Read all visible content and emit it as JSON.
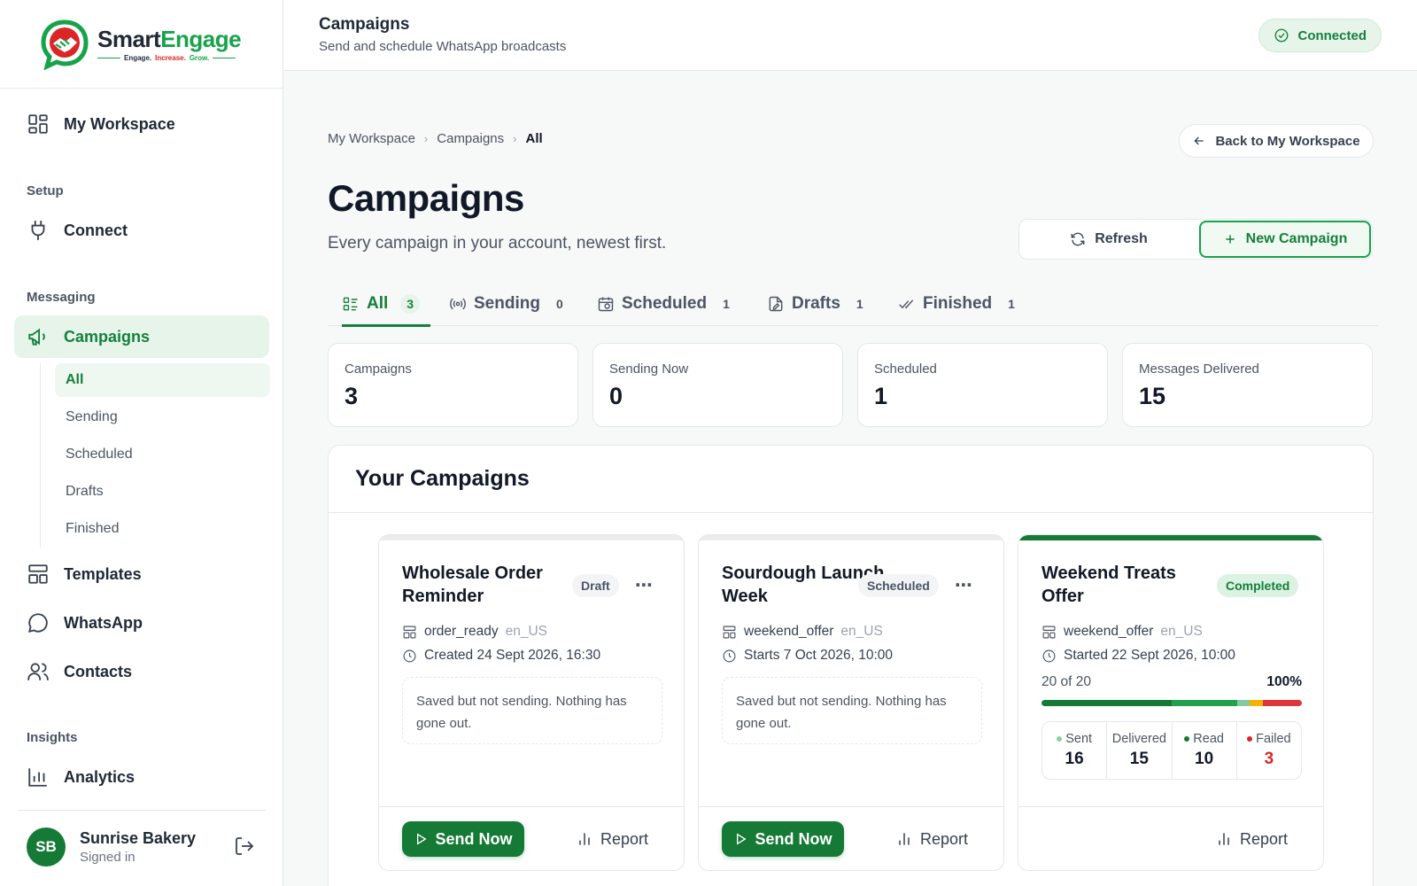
{
  "brand": {
    "name_part1": "Smart",
    "name_part2": "Engage",
    "tag1": "Engage.",
    "tag2": "Increase.",
    "tag3": "Grow."
  },
  "sidebar": {
    "workspace": "My Workspace",
    "setup_label": "Setup",
    "connect": "Connect",
    "messaging_label": "Messaging",
    "campaigns": "Campaigns",
    "sub": [
      "All",
      "Sending",
      "Scheduled",
      "Drafts",
      "Finished"
    ],
    "templates": "Templates",
    "whatsapp": "WhatsApp",
    "contacts": "Contacts",
    "insights_label": "Insights",
    "analytics": "Analytics",
    "user": {
      "initials": "SB",
      "name": "Sunrise Bakery",
      "status": "Signed in"
    }
  },
  "header": {
    "title": "Campaigns",
    "subtitle": "Send and schedule WhatsApp broadcasts",
    "status": "Connected"
  },
  "breadcrumb": [
    "My Workspace",
    "Campaigns",
    "All"
  ],
  "back_button": "Back to My Workspace",
  "page": {
    "title": "Campaigns",
    "subtitle": "Every campaign in your account, newest first.",
    "refresh": "Refresh",
    "new_campaign": "New Campaign"
  },
  "tabs": [
    {
      "label": "All",
      "count": "3"
    },
    {
      "label": "Sending",
      "count": "0"
    },
    {
      "label": "Scheduled",
      "count": "1"
    },
    {
      "label": "Drafts",
      "count": "1"
    },
    {
      "label": "Finished",
      "count": "1"
    }
  ],
  "stats": [
    {
      "label": "Campaigns",
      "value": "3"
    },
    {
      "label": "Sending Now",
      "value": "0"
    },
    {
      "label": "Scheduled",
      "value": "1"
    },
    {
      "label": "Messages Delivered",
      "value": "15"
    }
  ],
  "panel_title": "Your Campaigns",
  "cards": [
    {
      "title": "Wholesale Order Reminder",
      "badge": "Draft",
      "template": "order_ready",
      "locale": "en_US",
      "time": "Created 24 Sept 2026, 16:30",
      "note": "Saved but not sending. Nothing has gone out.",
      "send": "Send Now",
      "report": "Report"
    },
    {
      "title": "Sourdough Launch Week",
      "badge": "Scheduled",
      "template": "weekend_offer",
      "locale": "en_US",
      "time": "Starts 7 Oct 2026, 10:00",
      "note": "Saved but not sending. Nothing has gone out.",
      "send": "Send Now",
      "report": "Report"
    },
    {
      "title": "Weekend Treats Offer",
      "badge": "Completed",
      "template": "weekend_offer",
      "locale": "en_US",
      "time": "Started 22 Sept 2026, 10:00",
      "progress_text": "20 of 20",
      "progress_pct": "100%",
      "bar_colors": [
        "#157a35",
        "#22a04b",
        "#86c9a0",
        "#f5b301",
        "#e0353b"
      ],
      "bar_share": [
        0.5,
        0.25,
        0.05,
        0.05,
        0.15
      ],
      "metrics": [
        {
          "label": "Sent",
          "value": "16",
          "dot": "#86d29e"
        },
        {
          "label": "Delivered",
          "value": "15",
          "dot": ""
        },
        {
          "label": "Read",
          "value": "10",
          "dot": "#157a35"
        },
        {
          "label": "Failed",
          "value": "3",
          "dot": "#dc2626"
        }
      ],
      "report": "Report"
    }
  ]
}
